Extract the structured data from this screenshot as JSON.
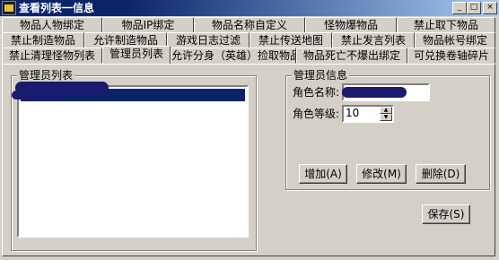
{
  "window": {
    "title": "查看列表一信息",
    "controls": {
      "minimize": "_",
      "maximize": "□",
      "close": "×"
    }
  },
  "tabs_row1": [
    "物品人物绑定",
    "物品IP绑定",
    "物品名称自定义",
    "怪物爆物品",
    "禁止取下物品"
  ],
  "tabs_row2": [
    "禁止制造物品",
    "允许制造物品",
    "游戏日志过滤",
    "禁止传送地图",
    "禁止发言列表",
    "物品帐号绑定"
  ],
  "tabs_row3": [
    "禁止清理怪物列表",
    "管理员列表",
    "允许分身（英雄）捡取物品",
    "物品死亡不爆出绑定",
    "可兑换卷轴碎片"
  ],
  "active_tab": "管理员列表",
  "admin_list": {
    "label": "管理员列表"
  },
  "admin_info": {
    "label": "管理员信息",
    "name_label": "角色名称:",
    "level_label": "角色等级:",
    "level_value": "10",
    "add_button": "增加(A)",
    "modify_button": "修改(M)",
    "delete_button": "删除(D)"
  },
  "save_button": "保存(S)"
}
